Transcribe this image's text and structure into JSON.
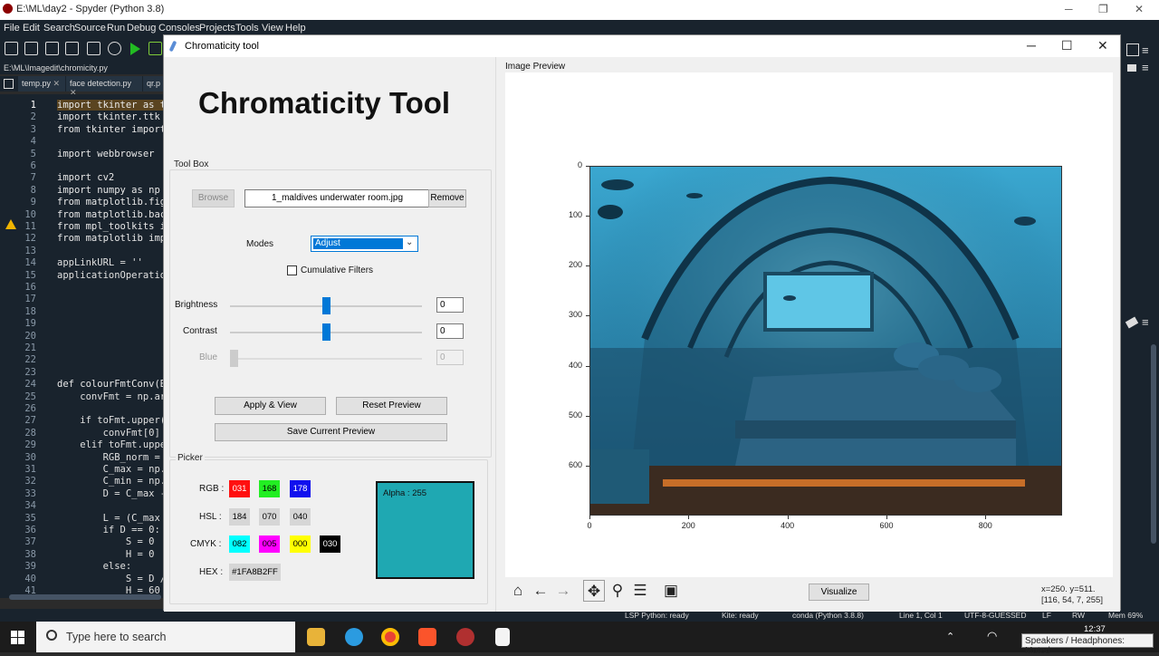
{
  "spyder": {
    "title": "E:\\ML\\day2 - Spyder (Python 3.8)",
    "menu": [
      "File",
      "Edit",
      "Search",
      "Source",
      "Run",
      "Debug",
      "Consoles",
      "Projects",
      "Tools",
      "View",
      "Help"
    ],
    "file_path": "E:\\ML\\Imagedit\\chromicity.py",
    "tabs": [
      "temp.py",
      "face detection.py",
      "qr.p"
    ],
    "line_numbers": [
      "1",
      "2",
      "3",
      "4",
      "5",
      "6",
      "7",
      "8",
      "9",
      "10",
      "11",
      "12",
      "13",
      "14",
      "15",
      "16",
      "17",
      "18",
      "19",
      "20",
      "21",
      "22",
      "23",
      "24",
      "25",
      "26",
      "27",
      "28",
      "29",
      "30",
      "31",
      "32",
      "33",
      "34",
      "35",
      "36",
      "37",
      "38",
      "39",
      "40",
      "41"
    ],
    "code": [
      "import tkinter as tk",
      "import tkinter.ttk as",
      "from tkinter import",
      "",
      "import webbrowser",
      "",
      "import cv2",
      "import numpy as np",
      "from matplotlib.figu",
      "from matplotlib.back",
      "from mpl_toolkits im",
      "from matplotlib impo",
      "",
      "appLinkURL = ''",
      "applicationOperation",
      "",
      "",
      "",
      "",
      "",
      "",
      "",
      "",
      "def colourFmtConv(Bt",
      "    convFmt = np.arr",
      "",
      "    if toFmt.upper(",
      "        convFmt[0] =",
      "    elif toFmt.upper",
      "        RGB_norm = B",
      "        C_max = np.m",
      "        C_min = np.m",
      "        D = C_max - ",
      "",
      "        L = (C_max -",
      "        if D == 0:",
      "            S = 0",
      "            H = 0",
      "        else:",
      "            S = D /",
      "            H = 60"
    ],
    "status": {
      "lsp": "LSP Python: ready",
      "kite": "Kite: ready",
      "conda": "conda (Python 3.8.8)",
      "pos": "Line 1, Col 1",
      "enc": "UTF-8-GUESSED",
      "eol": "LF",
      "rw": "RW",
      "mem": "Mem 69%"
    }
  },
  "taskbar": {
    "search_placeholder": "Type here to search",
    "time": "12:37",
    "tooltip": "Speakers / Headphones: Muted"
  },
  "window": {
    "title": "Chromaticity tool"
  },
  "app": {
    "heading": "Chromaticity Tool",
    "toolbox_label": "Tool Box",
    "browse_label": "Browse",
    "filename": "1_maldives underwater room.jpg",
    "remove_label": "Remove",
    "modes_label": "Modes",
    "mode_value": "Adjust",
    "cumulative_label": "Cumulative Filters",
    "sliders": [
      {
        "label": "Brightness",
        "value": "0",
        "level": 0.5,
        "enabled": true
      },
      {
        "label": "Contrast",
        "value": "0",
        "level": 0.5,
        "enabled": true
      },
      {
        "label": "Blue",
        "value": "0",
        "level": 0.0,
        "enabled": false
      }
    ],
    "apply_label": "Apply & View",
    "reset_label": "Reset Preview",
    "save_label": "Save Current Preview",
    "picker_label": "Picker",
    "rgb_label": "RGB :",
    "rgb": [
      {
        "v": "031",
        "bg": "#ff1010",
        "fg": "#ffffff"
      },
      {
        "v": "168",
        "bg": "#22ee22",
        "fg": "#000000"
      },
      {
        "v": "178",
        "bg": "#1010ee",
        "fg": "#ffffff"
      }
    ],
    "hsl_label": "HSL :",
    "hsl": [
      "184",
      "070",
      "040"
    ],
    "cmyk_label": "CMYK :",
    "cmyk": [
      {
        "v": "082",
        "bg": "#00ffff",
        "fg": "#000000"
      },
      {
        "v": "005",
        "bg": "#ff00ff",
        "fg": "#000000"
      },
      {
        "v": "000",
        "bg": "#ffff00",
        "fg": "#000000"
      },
      {
        "v": "030",
        "bg": "#000000",
        "fg": "#ffffff"
      }
    ],
    "hex_label": "HEX :",
    "hex": "#1FA8B2FF",
    "alpha": "Alpha : 255",
    "swatch_color": "#1fa8b2"
  },
  "preview": {
    "label": "Image Preview",
    "y_ticks": [
      "0",
      "100",
      "200",
      "300",
      "400",
      "500",
      "600"
    ],
    "x_ticks": [
      "0",
      "200",
      "400",
      "600",
      "800"
    ],
    "visualize_label": "Visualize",
    "coord_line1": "x=250. y=511.",
    "coord_line2": "[116, 54, 7, 255]"
  }
}
